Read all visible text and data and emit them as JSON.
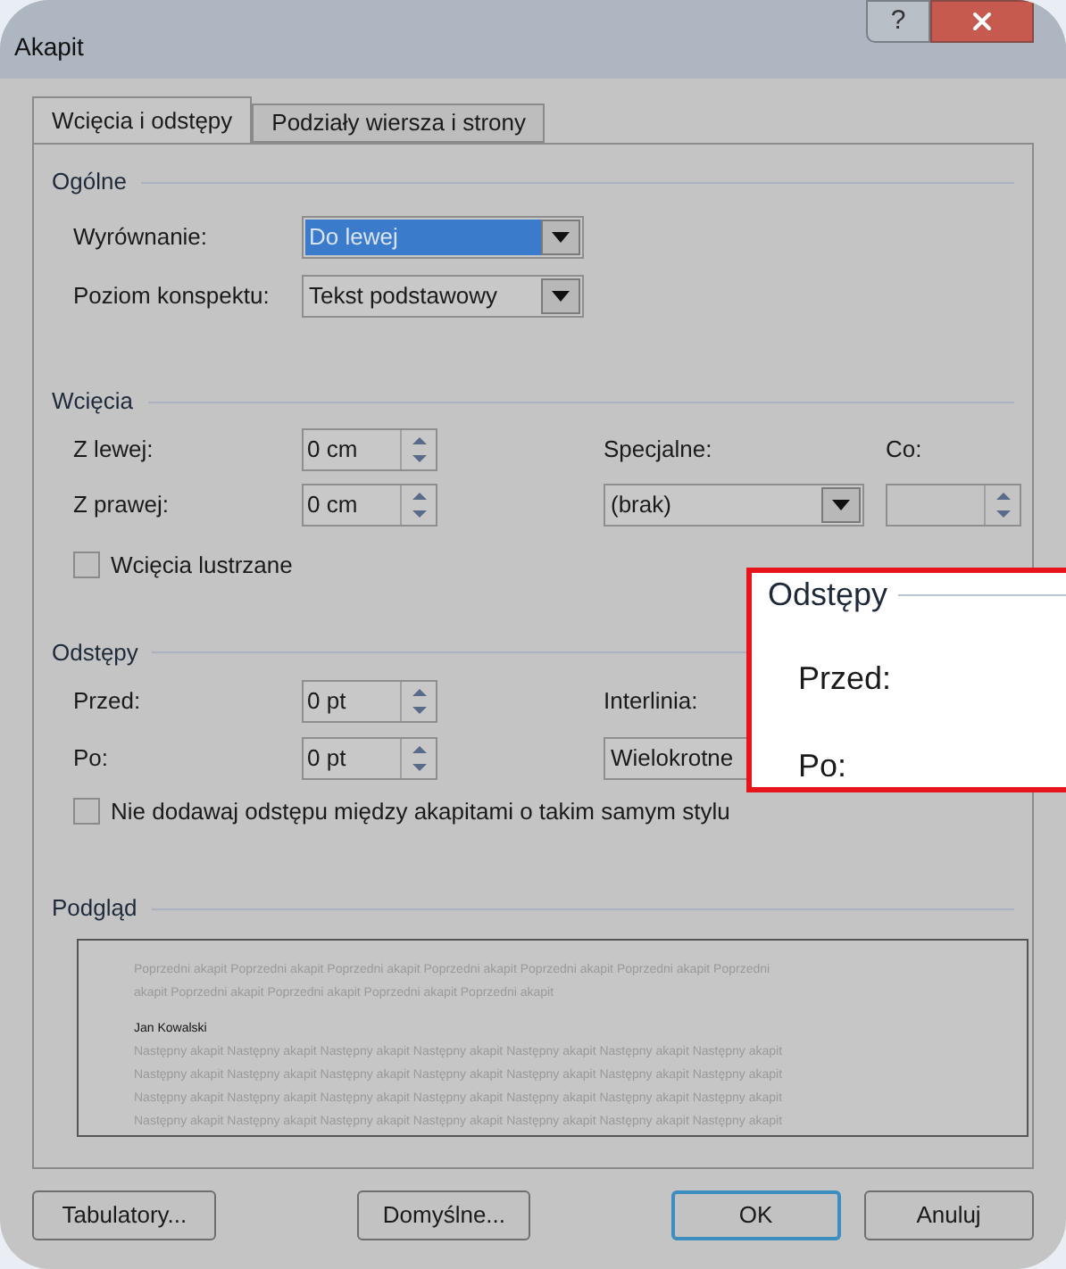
{
  "window": {
    "title": "Akapit",
    "help": "?"
  },
  "tabs": [
    {
      "label": "Wcięcia i odstępy",
      "selected": true
    },
    {
      "label": "Podziały wiersza i strony",
      "selected": false
    }
  ],
  "general": {
    "title": "Ogólne",
    "alignment": {
      "label": "Wyrównanie:",
      "value": "Do lewej",
      "selected": true
    },
    "outline": {
      "label": "Poziom konspektu:",
      "value": "Tekst podstawowy",
      "selected": false
    }
  },
  "indents": {
    "title": "Wcięcia",
    "left": {
      "label": "Z lewej:",
      "value": "0 cm"
    },
    "right": {
      "label": "Z prawej:",
      "value": "0 cm"
    },
    "special": {
      "label": "Specjalne:",
      "value": "(brak)"
    },
    "by": {
      "label": "Co:"
    },
    "mirror": {
      "label": "Wcięcia lustrzane",
      "checked": false
    }
  },
  "spacing": {
    "title": "Odstępy",
    "before": {
      "label": "Przed:",
      "value": "0 pt"
    },
    "after": {
      "label": "Po:",
      "value": "0 pt"
    },
    "line_spacing": {
      "label": "Interlinia:",
      "value": "Wielokrotne"
    },
    "no_space": {
      "label": "Nie dodawaj odstępu między akapitami o takim samym stylu",
      "checked": false
    }
  },
  "preview": {
    "title": "Podgląd",
    "previous": [
      "Poprzedni akapit Poprzedni akapit Poprzedni akapit Poprzedni akapit Poprzedni akapit Poprzedni akapit Poprzedni",
      "akapit Poprzedni akapit Poprzedni akapit Poprzedni akapit Poprzedni akapit"
    ],
    "sample": "Jan Kowalski",
    "next": [
      "Następny akapit Następny akapit Następny akapit Następny akapit Następny akapit Następny akapit Następny akapit",
      "Następny akapit Następny akapit Następny akapit Następny akapit Następny akapit Następny akapit Następny akapit",
      "Następny akapit Następny akapit Następny akapit Następny akapit Następny akapit Następny akapit Następny akapit",
      "Następny akapit Następny akapit Następny akapit Następny akapit Następny akapit Następny akapit Następny akapit"
    ]
  },
  "buttons": [
    {
      "label": "Tabulatory...",
      "default": false
    },
    {
      "label": "Domyślne...",
      "default": false
    },
    {
      "label": "OK",
      "default": true
    },
    {
      "label": "Anuluj",
      "default": false
    }
  ],
  "callout": {
    "title": "Odstępy",
    "labels": [
      "Przed:",
      "Po:"
    ]
  }
}
